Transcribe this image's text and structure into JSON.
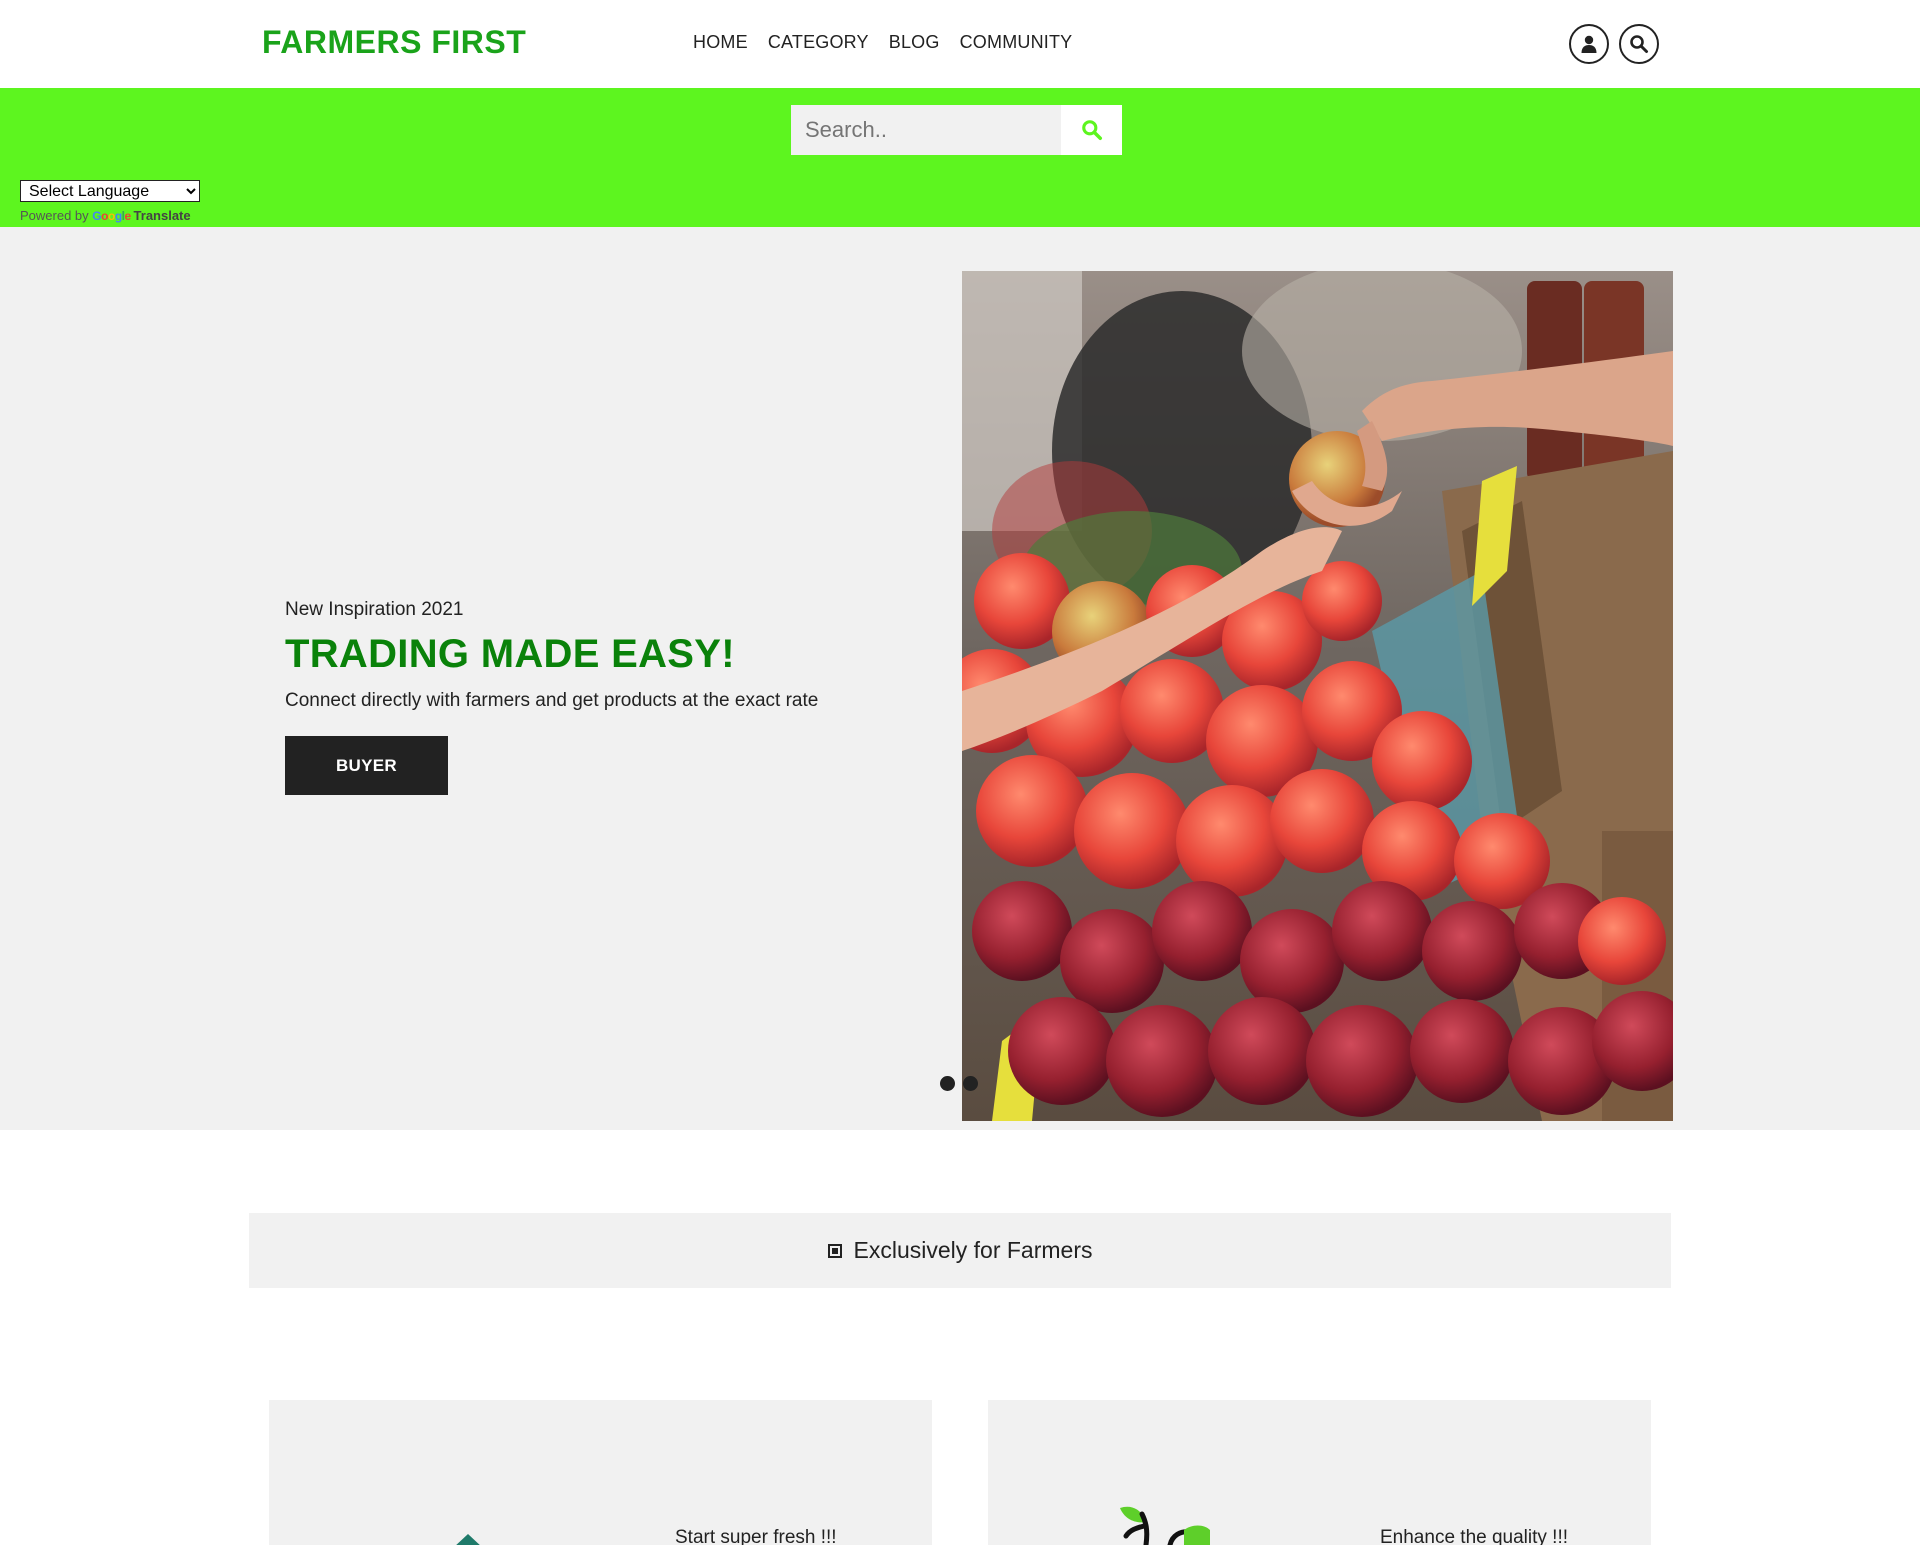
{
  "header": {
    "logo": "FARMERS FIRST",
    "nav": [
      "HOME",
      "CATEGORY",
      "BLOG",
      "COMMUNITY"
    ],
    "icons": [
      "user-icon",
      "search-icon"
    ]
  },
  "searchbar": {
    "placeholder": "Search..",
    "button_icon": "search-icon",
    "accent": "#5df51f"
  },
  "translate": {
    "select_label": "Select Language",
    "powered_by": "Powered by",
    "google": "Google",
    "translate": "Translate"
  },
  "hero": {
    "kicker": "New Inspiration 2021",
    "title": "TRADING MADE EASY!",
    "subtitle": "Connect directly with farmers and get products at the exact rate",
    "button": "BUYER",
    "image_alt": "hands exchanging a peach at a fruit market",
    "slides": 2
  },
  "exclusive": {
    "label": "Exclusively for Farmers"
  },
  "cards": [
    {
      "text": "Start super fresh !!!",
      "icon": "sprout-icon"
    },
    {
      "text": "Enhance the quality !!!",
      "icon": "branch-leaf-icon"
    }
  ],
  "colors": {
    "brand_green": "#1aa31a",
    "title_green": "#0a820a",
    "bar_green": "#5df51f",
    "dark": "#222222"
  }
}
